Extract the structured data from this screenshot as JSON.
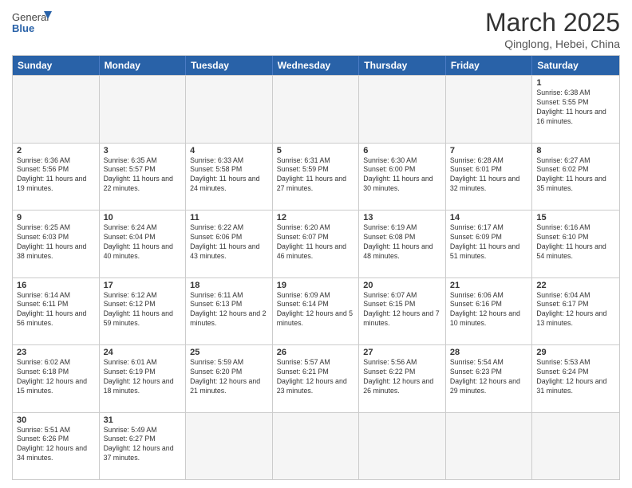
{
  "header": {
    "logo_general": "General",
    "logo_blue": "Blue",
    "month_title": "March 2025",
    "subtitle": "Qinglong, Hebei, China"
  },
  "weekdays": [
    "Sunday",
    "Monday",
    "Tuesday",
    "Wednesday",
    "Thursday",
    "Friday",
    "Saturday"
  ],
  "rows": [
    [
      {
        "day": "",
        "info": "",
        "empty": true
      },
      {
        "day": "",
        "info": "",
        "empty": true
      },
      {
        "day": "",
        "info": "",
        "empty": true
      },
      {
        "day": "",
        "info": "",
        "empty": true
      },
      {
        "day": "",
        "info": "",
        "empty": true
      },
      {
        "day": "",
        "info": "",
        "empty": true
      },
      {
        "day": "1",
        "info": "Sunrise: 6:38 AM\nSunset: 5:55 PM\nDaylight: 11 hours and 16 minutes.",
        "empty": false
      }
    ],
    [
      {
        "day": "2",
        "info": "Sunrise: 6:36 AM\nSunset: 5:56 PM\nDaylight: 11 hours and 19 minutes.",
        "empty": false
      },
      {
        "day": "3",
        "info": "Sunrise: 6:35 AM\nSunset: 5:57 PM\nDaylight: 11 hours and 22 minutes.",
        "empty": false
      },
      {
        "day": "4",
        "info": "Sunrise: 6:33 AM\nSunset: 5:58 PM\nDaylight: 11 hours and 24 minutes.",
        "empty": false
      },
      {
        "day": "5",
        "info": "Sunrise: 6:31 AM\nSunset: 5:59 PM\nDaylight: 11 hours and 27 minutes.",
        "empty": false
      },
      {
        "day": "6",
        "info": "Sunrise: 6:30 AM\nSunset: 6:00 PM\nDaylight: 11 hours and 30 minutes.",
        "empty": false
      },
      {
        "day": "7",
        "info": "Sunrise: 6:28 AM\nSunset: 6:01 PM\nDaylight: 11 hours and 32 minutes.",
        "empty": false
      },
      {
        "day": "8",
        "info": "Sunrise: 6:27 AM\nSunset: 6:02 PM\nDaylight: 11 hours and 35 minutes.",
        "empty": false
      }
    ],
    [
      {
        "day": "9",
        "info": "Sunrise: 6:25 AM\nSunset: 6:03 PM\nDaylight: 11 hours and 38 minutes.",
        "empty": false
      },
      {
        "day": "10",
        "info": "Sunrise: 6:24 AM\nSunset: 6:04 PM\nDaylight: 11 hours and 40 minutes.",
        "empty": false
      },
      {
        "day": "11",
        "info": "Sunrise: 6:22 AM\nSunset: 6:06 PM\nDaylight: 11 hours and 43 minutes.",
        "empty": false
      },
      {
        "day": "12",
        "info": "Sunrise: 6:20 AM\nSunset: 6:07 PM\nDaylight: 11 hours and 46 minutes.",
        "empty": false
      },
      {
        "day": "13",
        "info": "Sunrise: 6:19 AM\nSunset: 6:08 PM\nDaylight: 11 hours and 48 minutes.",
        "empty": false
      },
      {
        "day": "14",
        "info": "Sunrise: 6:17 AM\nSunset: 6:09 PM\nDaylight: 11 hours and 51 minutes.",
        "empty": false
      },
      {
        "day": "15",
        "info": "Sunrise: 6:16 AM\nSunset: 6:10 PM\nDaylight: 11 hours and 54 minutes.",
        "empty": false
      }
    ],
    [
      {
        "day": "16",
        "info": "Sunrise: 6:14 AM\nSunset: 6:11 PM\nDaylight: 11 hours and 56 minutes.",
        "empty": false
      },
      {
        "day": "17",
        "info": "Sunrise: 6:12 AM\nSunset: 6:12 PM\nDaylight: 11 hours and 59 minutes.",
        "empty": false
      },
      {
        "day": "18",
        "info": "Sunrise: 6:11 AM\nSunset: 6:13 PM\nDaylight: 12 hours and 2 minutes.",
        "empty": false
      },
      {
        "day": "19",
        "info": "Sunrise: 6:09 AM\nSunset: 6:14 PM\nDaylight: 12 hours and 5 minutes.",
        "empty": false
      },
      {
        "day": "20",
        "info": "Sunrise: 6:07 AM\nSunset: 6:15 PM\nDaylight: 12 hours and 7 minutes.",
        "empty": false
      },
      {
        "day": "21",
        "info": "Sunrise: 6:06 AM\nSunset: 6:16 PM\nDaylight: 12 hours and 10 minutes.",
        "empty": false
      },
      {
        "day": "22",
        "info": "Sunrise: 6:04 AM\nSunset: 6:17 PM\nDaylight: 12 hours and 13 minutes.",
        "empty": false
      }
    ],
    [
      {
        "day": "23",
        "info": "Sunrise: 6:02 AM\nSunset: 6:18 PM\nDaylight: 12 hours and 15 minutes.",
        "empty": false
      },
      {
        "day": "24",
        "info": "Sunrise: 6:01 AM\nSunset: 6:19 PM\nDaylight: 12 hours and 18 minutes.",
        "empty": false
      },
      {
        "day": "25",
        "info": "Sunrise: 5:59 AM\nSunset: 6:20 PM\nDaylight: 12 hours and 21 minutes.",
        "empty": false
      },
      {
        "day": "26",
        "info": "Sunrise: 5:57 AM\nSunset: 6:21 PM\nDaylight: 12 hours and 23 minutes.",
        "empty": false
      },
      {
        "day": "27",
        "info": "Sunrise: 5:56 AM\nSunset: 6:22 PM\nDaylight: 12 hours and 26 minutes.",
        "empty": false
      },
      {
        "day": "28",
        "info": "Sunrise: 5:54 AM\nSunset: 6:23 PM\nDaylight: 12 hours and 29 minutes.",
        "empty": false
      },
      {
        "day": "29",
        "info": "Sunrise: 5:53 AM\nSunset: 6:24 PM\nDaylight: 12 hours and 31 minutes.",
        "empty": false
      }
    ],
    [
      {
        "day": "30",
        "info": "Sunrise: 5:51 AM\nSunset: 6:26 PM\nDaylight: 12 hours and 34 minutes.",
        "empty": false
      },
      {
        "day": "31",
        "info": "Sunrise: 5:49 AM\nSunset: 6:27 PM\nDaylight: 12 hours and 37 minutes.",
        "empty": false
      },
      {
        "day": "",
        "info": "",
        "empty": true
      },
      {
        "day": "",
        "info": "",
        "empty": true
      },
      {
        "day": "",
        "info": "",
        "empty": true
      },
      {
        "day": "",
        "info": "",
        "empty": true
      },
      {
        "day": "",
        "info": "",
        "empty": true
      }
    ]
  ]
}
